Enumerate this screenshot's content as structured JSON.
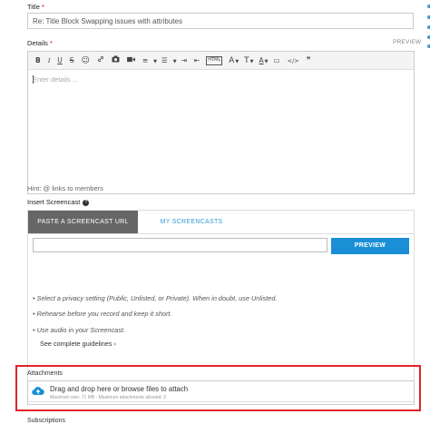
{
  "title_field": {
    "label": "Title",
    "required_mark": "*",
    "value": "Re: Title Block Swapping issues with attributes"
  },
  "details_field": {
    "label": "Details",
    "required_mark": "*",
    "preview_label": "PREVIEW",
    "placeholder": "Enter details ...",
    "hint": "Hint: @ links to members"
  },
  "toolbar": {
    "bold": "B",
    "italic": "I",
    "underline": "U",
    "strikethrough": "S",
    "emoji": "☺",
    "link": "🔗",
    "image": "📷",
    "video": "■",
    "numbered_list": "≡",
    "bulleted_list": "☰",
    "indent": "⇥",
    "outdent": "⇤",
    "html": "HTML",
    "font_size": "A",
    "text_style": "T",
    "font_color": "A",
    "background": "▭",
    "code": "</>",
    "quote": "❞",
    "dropdown": "▼"
  },
  "screencast": {
    "label": "Insert Screencast",
    "help_icon": "?",
    "tabs": [
      "PASTE A SCREENCAST URL",
      "MY SCREENCASTS"
    ],
    "url_value": "",
    "preview_button": "PREVIEW",
    "tips": [
      "Select a privacy setting (Public, Unlisted, or Private). When in doubt, use Unlisted.",
      "Rehearse before you record and keep it short.",
      "Use audio in your Screencast."
    ],
    "guidelines_link": "See complete guidelines ›"
  },
  "attachments": {
    "label": "Attachments",
    "drop_text": "Drag and drop here or browse files to attach",
    "limits": "Maximum size: 71 MB - Maximum attachments allowed: 3"
  },
  "subscriptions": {
    "label": "Subscriptions"
  },
  "colors": {
    "accent": "#1a8fd6",
    "highlight_border": "#e2222a",
    "active_tab": "#666666"
  }
}
